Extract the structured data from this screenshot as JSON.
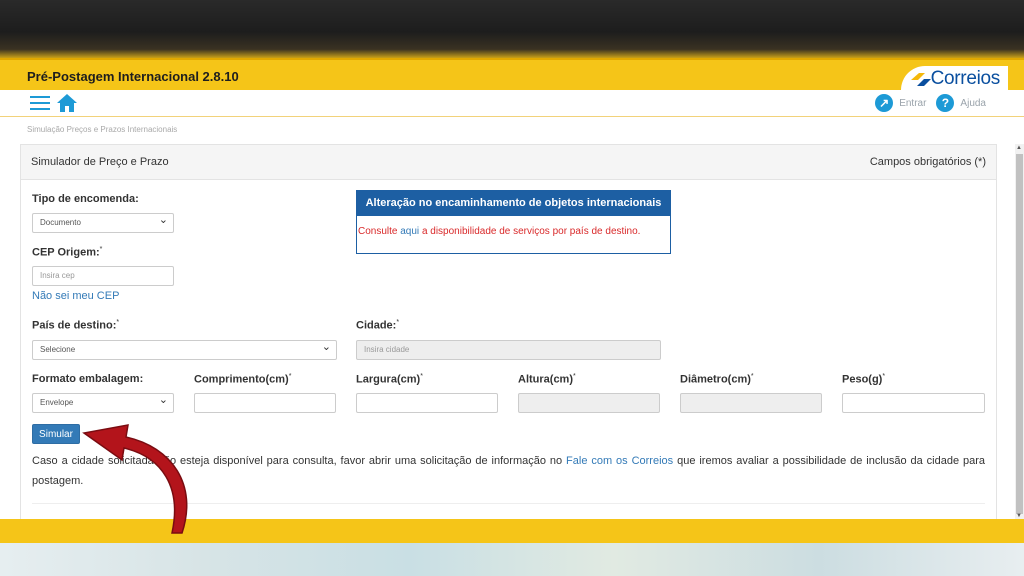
{
  "app": {
    "title": "Pré-Postagem Internacional 2.8.10",
    "logo_text": "Correios"
  },
  "nav": {
    "login_label": "Entrar",
    "help_label": "Ajuda"
  },
  "breadcrumb": "Simulação Preços e Prazos Internacionais",
  "panel": {
    "title": "Simulador de Preço e Prazo",
    "required_note": "Campos obrigatórios (*)"
  },
  "form": {
    "tipo_label": "Tipo de encomenda:",
    "tipo_value": "Documento",
    "cep_label": "CEP Origem:",
    "cep_placeholder": "Insira cep",
    "cep_help_link": "Não sei meu CEP",
    "pais_label": "País de destino:",
    "pais_value": "Selecione",
    "cidade_label": "Cidade:",
    "cidade_placeholder": "Insira cidade",
    "formato_label": "Formato embalagem:",
    "formato_value": "Envelope",
    "comprimento_label": "Comprimento(cm)",
    "largura_label": "Largura(cm)",
    "altura_label": "Altura(cm)",
    "diametro_label": "Diâmetro(cm)",
    "peso_label": "Peso(g)",
    "required_mark": "*",
    "submit_label": "Simular"
  },
  "alert": {
    "title": "Alteração no encaminhamento de objetos internacionais",
    "text_before": "Consulte",
    "link": "aqui",
    "text_after": "a disponibilidade de serviços por país de destino."
  },
  "info": {
    "text_before": "Caso a cidade solicitada não esteja disponível para consulta, favor abrir uma solicitação de informação no",
    "link": "Fale com os Correios",
    "text_after": "que iremos avaliar a possibilidade de inclusão da cidade para postagem."
  },
  "colors": {
    "brand_yellow": "#f5c518",
    "brand_blue": "#0a4f9f",
    "link_blue": "#337ab7",
    "alert_red": "#d9292a",
    "annotation_arrow": "#b3141b"
  }
}
